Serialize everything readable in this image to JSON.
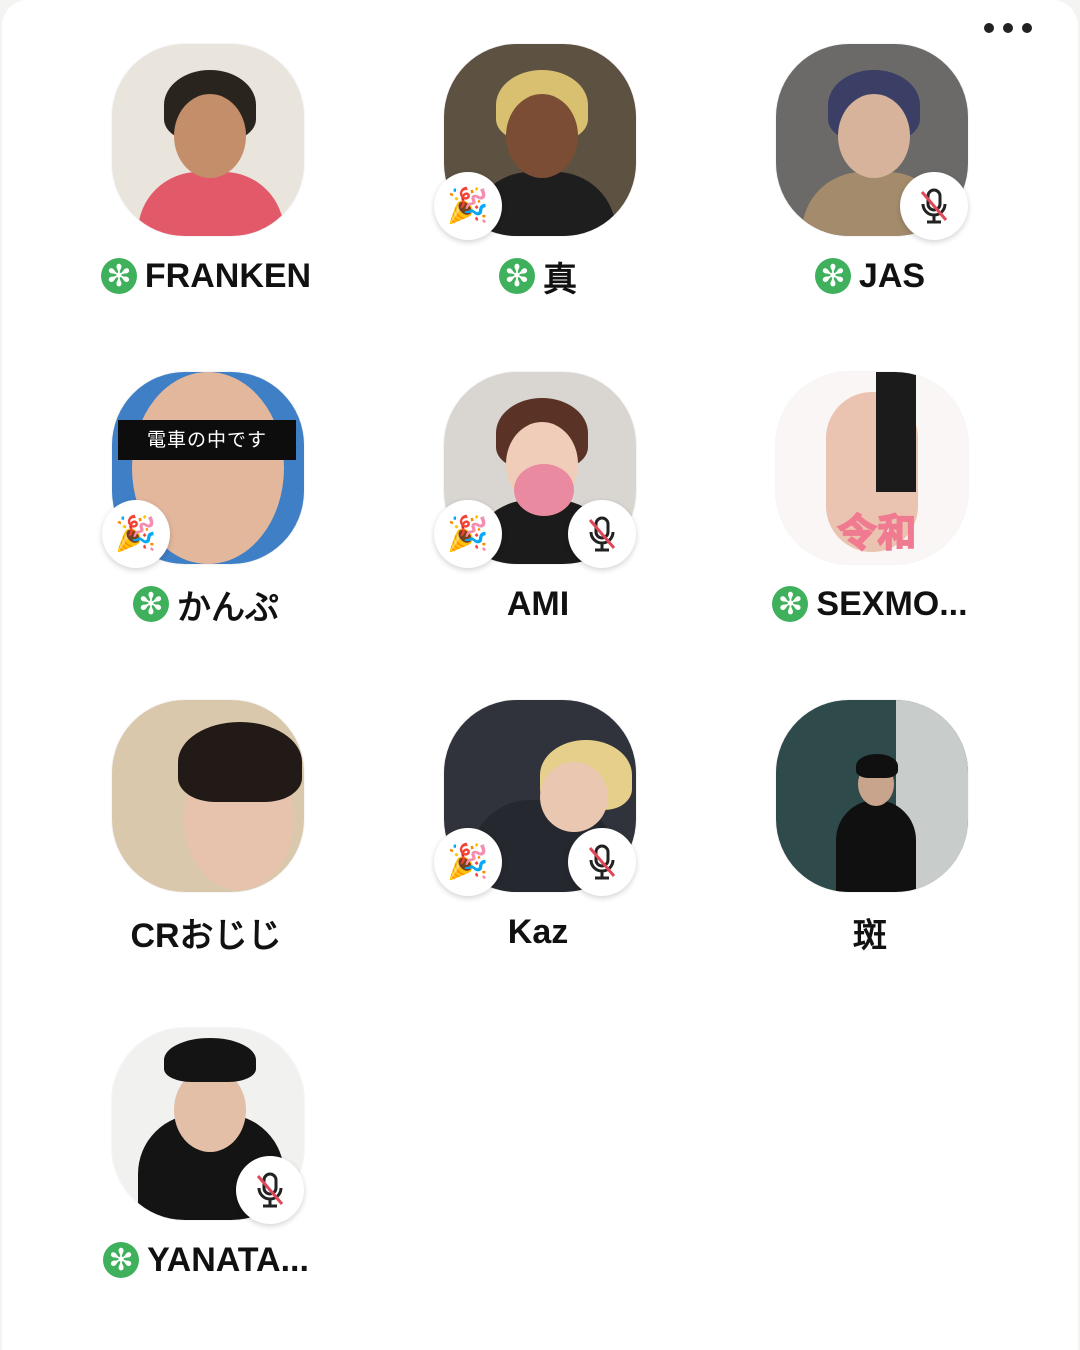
{
  "app": {
    "more_icon": "more-horizontal-icon"
  },
  "colors": {
    "new_member_badge": "#3fb05b",
    "mute_slash": "#e0485a"
  },
  "speakers": [
    {
      "name": "FRANKEN",
      "new_member": true,
      "badges": []
    },
    {
      "name": "真",
      "new_member": true,
      "badges": [
        "party-popper"
      ]
    },
    {
      "name": "JAS",
      "new_member": true,
      "badges": [
        "muted-mic"
      ]
    },
    {
      "name": "かんぷ",
      "new_member": true,
      "badges": [
        "party-popper"
      ],
      "avatar_text": "電車の中です"
    },
    {
      "name": "AMI",
      "new_member": false,
      "badges": [
        "party-popper",
        "muted-mic"
      ]
    },
    {
      "name": "SEXMO...",
      "new_member": true,
      "badges": [],
      "avatar_text": "令和"
    },
    {
      "name": "CRおじじ",
      "new_member": false,
      "badges": []
    },
    {
      "name": "Kaz",
      "new_member": false,
      "badges": [
        "party-popper",
        "muted-mic"
      ]
    },
    {
      "name": "斑",
      "new_member": false,
      "badges": []
    },
    {
      "name": "YANATA...",
      "new_member": true,
      "badges": [
        "muted-mic"
      ]
    }
  ]
}
